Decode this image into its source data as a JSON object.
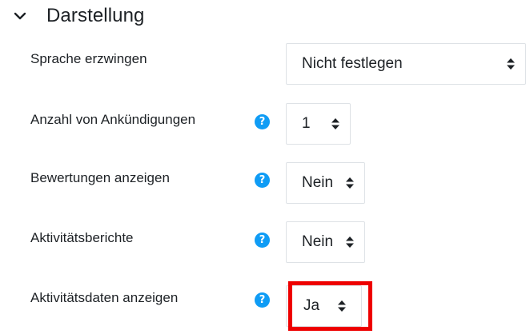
{
  "section": {
    "title": "Darstellung",
    "icon": "chevron-down-icon"
  },
  "rows": [
    {
      "label": "Sprache erzwingen",
      "value": "Nicht festlegen",
      "has_help": false
    },
    {
      "label": "Anzahl von Ankündigungen",
      "value": "1",
      "has_help": true
    },
    {
      "label": "Bewertungen anzeigen",
      "value": "Nein",
      "has_help": true
    },
    {
      "label": "Aktivitätsberichte",
      "value": "Nein",
      "has_help": true
    },
    {
      "label": "Aktivitätsdaten anzeigen",
      "value": "Ja",
      "has_help": true
    }
  ],
  "help_glyph": "?",
  "colors": {
    "help_icon": "#0f9cf5",
    "highlight": "#ee0000",
    "select_border": "#dee2e6"
  }
}
